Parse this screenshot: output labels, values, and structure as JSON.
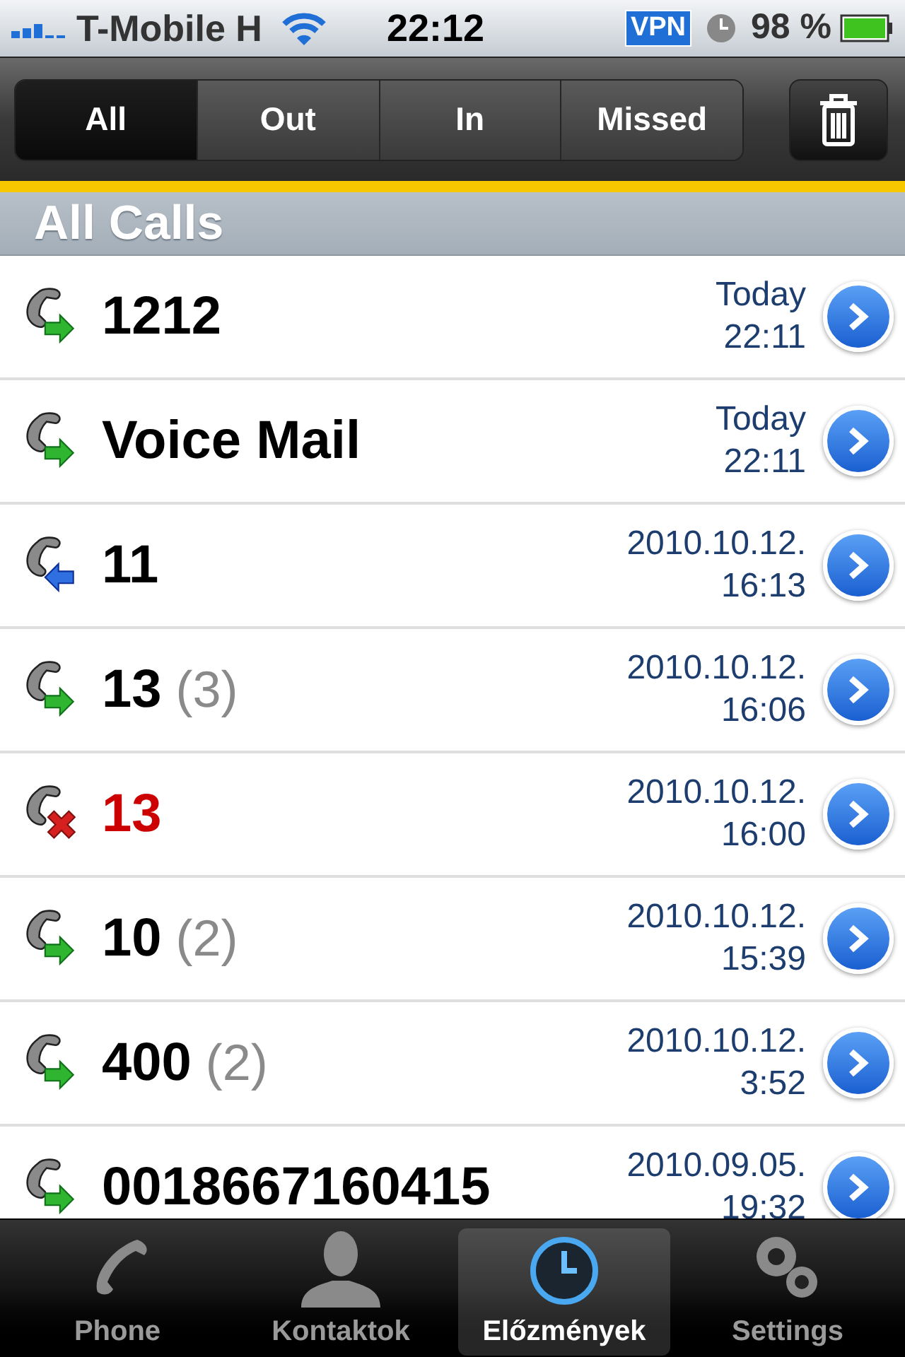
{
  "status_bar": {
    "carrier": "T-Mobile H",
    "time": "22:12",
    "vpn": "VPN",
    "battery": "98 %"
  },
  "filter": [
    {
      "label": "All",
      "selected": true
    },
    {
      "label": "Out",
      "selected": false
    },
    {
      "label": "In",
      "selected": false
    },
    {
      "label": "Missed",
      "selected": false
    }
  ],
  "section_title": "All Calls",
  "calls": [
    {
      "kind": "out",
      "name": "1212",
      "date": "Today",
      "time": "22:11"
    },
    {
      "kind": "out",
      "name": "Voice Mail",
      "date": "Today",
      "time": "22:11"
    },
    {
      "kind": "in",
      "name": "11",
      "date": "2010.10.12.",
      "time": "16:13"
    },
    {
      "kind": "out",
      "name": "13",
      "count": "(3)",
      "date": "2010.10.12.",
      "time": "16:06"
    },
    {
      "kind": "missed",
      "name": "13",
      "date": "2010.10.12.",
      "time": "16:00"
    },
    {
      "kind": "out",
      "name": "10",
      "count": "(2)",
      "date": "2010.10.12.",
      "time": "15:39"
    },
    {
      "kind": "out",
      "name": "400",
      "count": "(2)",
      "date": "2010.10.12.",
      "time": "3:52"
    },
    {
      "kind": "out",
      "name": "0018667160415",
      "date": "2010.09.05.",
      "time": "19:32"
    }
  ],
  "tab_bar": [
    {
      "kind": "phone",
      "label": "Phone",
      "selected": false
    },
    {
      "kind": "contacts",
      "label": "Kontaktok",
      "selected": false
    },
    {
      "kind": "history",
      "label": "Előzmények",
      "selected": true
    },
    {
      "kind": "settings",
      "label": "Settings",
      "selected": false
    }
  ]
}
